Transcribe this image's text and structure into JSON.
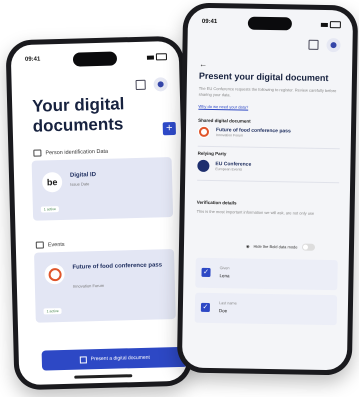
{
  "left_phone": {
    "status_time": "09:41",
    "title": "Your digital documents",
    "add_label": "+",
    "section1": "Person identification Data",
    "card1": {
      "logo": "be",
      "title": "Digital ID",
      "sub": "Issue Date",
      "badge": "1 active"
    },
    "section2": "Events",
    "card2": {
      "title": "Future of food conference pass",
      "sub": "Innovation Forum",
      "badge": "1 active"
    },
    "present_button": "Present a digital document"
  },
  "right_phone": {
    "status_time": "09:41",
    "back": "←",
    "title": "Present your digital document",
    "intro": "The EU Conference requests the following to register. Review carefully before sharing your data.",
    "link": "Why do we need your data?",
    "shared_label": "Shared digital document",
    "shared_doc_title": "Future of food conference pass",
    "shared_doc_sub": "Innovation Forum",
    "relying_label": "Relying Party",
    "relying_title": "EU Conference",
    "relying_sub": "European Events",
    "verify_label": "Verification details",
    "verify_text": "This is the most important information we will ask, are not only use",
    "toggle_label": "Hide the Bold data mode",
    "fields": [
      {
        "name": "Given",
        "value": "Lena"
      },
      {
        "name": "Last name",
        "value": "Doe"
      }
    ]
  }
}
